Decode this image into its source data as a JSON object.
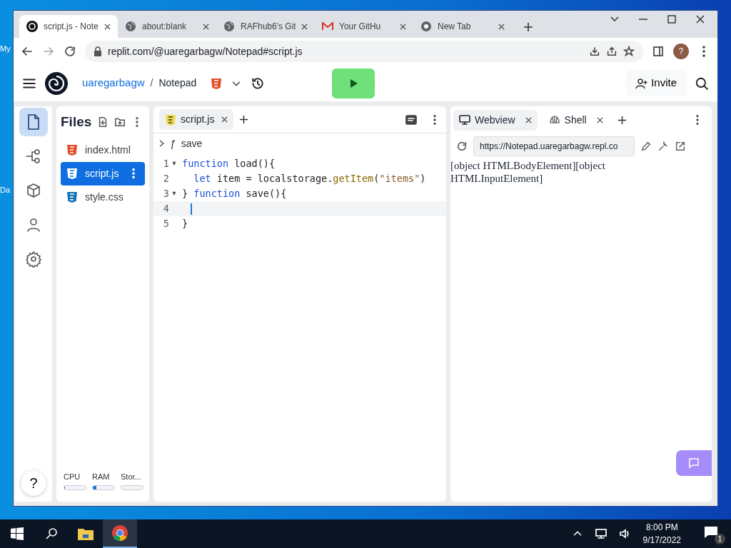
{
  "desktop": {
    "labels": [
      "My",
      "Da"
    ]
  },
  "browser": {
    "tabs": [
      {
        "label": "script.js - Note",
        "kind": "replit",
        "selected": true
      },
      {
        "label": "about:blank",
        "kind": "globe",
        "selected": false
      },
      {
        "label": "RAFhub6's Git",
        "kind": "globe",
        "selected": false
      },
      {
        "label": "Your GitHu",
        "kind": "mail",
        "selected": false
      },
      {
        "label": "New Tab",
        "kind": "chrome",
        "selected": false
      }
    ],
    "url": "replit.com/@uaregarbagw/Notepad#script.js",
    "profile": "?"
  },
  "header": {
    "user": "uaregarbagw",
    "separator": "/",
    "repl": "Notepad",
    "invite": "Invite"
  },
  "rail": {
    "items": [
      {
        "kind": "file",
        "selected": true
      },
      {
        "kind": "branch",
        "selected": false
      },
      {
        "kind": "cube",
        "selected": false
      },
      {
        "kind": "person",
        "selected": false
      },
      {
        "kind": "gear",
        "selected": false
      }
    ],
    "help": "?"
  },
  "files": {
    "title": "Files",
    "items": [
      {
        "name": "index.html",
        "kind": "html",
        "selected": false
      },
      {
        "name": "script.js",
        "kind": "js",
        "selected": true
      },
      {
        "name": "style.css",
        "kind": "css",
        "selected": false
      }
    ],
    "meters": [
      {
        "label": "CPU",
        "level": 0.02
      },
      {
        "label": "RAM",
        "level": 0.18
      },
      {
        "label": "Stor...",
        "level": 0
      }
    ]
  },
  "editor": {
    "tab": "script.js",
    "breadcrumb": {
      "symbol": "ƒ",
      "name": "save"
    },
    "lines": [
      {
        "number": "1",
        "fold": "▼",
        "tokens": [
          {
            "kind": "keyword",
            "text": "function "
          },
          {
            "kind": "plain",
            "text": "load(){"
          }
        ]
      },
      {
        "number": "2",
        "tokens": [
          {
            "kind": "keyword",
            "text": "  let "
          },
          {
            "kind": "plain",
            "text": "item = localstorage."
          },
          {
            "kind": "fn",
            "text": "getItem"
          },
          {
            "kind": "plain",
            "text": "("
          },
          {
            "kind": "string",
            "text": "\"items\""
          },
          {
            "kind": "plain",
            "text": ")"
          }
        ]
      },
      {
        "number": "3",
        "fold": "▼",
        "tokens": [
          {
            "kind": "plain",
            "text": "} "
          },
          {
            "kind": "keyword",
            "text": "function "
          },
          {
            "kind": "plain",
            "text": "save(){"
          }
        ]
      },
      {
        "number": "4",
        "cursor": true
      },
      {
        "number": "5",
        "tokens": [
          {
            "kind": "plain",
            "text": "}"
          }
        ]
      }
    ]
  },
  "preview": {
    "tabs": [
      {
        "label": "Webview",
        "kind": "monitor",
        "selected": true
      },
      {
        "label": "Shell",
        "kind": "shell",
        "selected": false
      }
    ],
    "url": "https://Notepad.uaregarbagw.repl.co",
    "output": "[object HTMLBodyElement][object HTMLInputElement]"
  },
  "taskbar": {
    "time": "8:00 PM",
    "date": "9/17/2022",
    "notifications": "1"
  }
}
